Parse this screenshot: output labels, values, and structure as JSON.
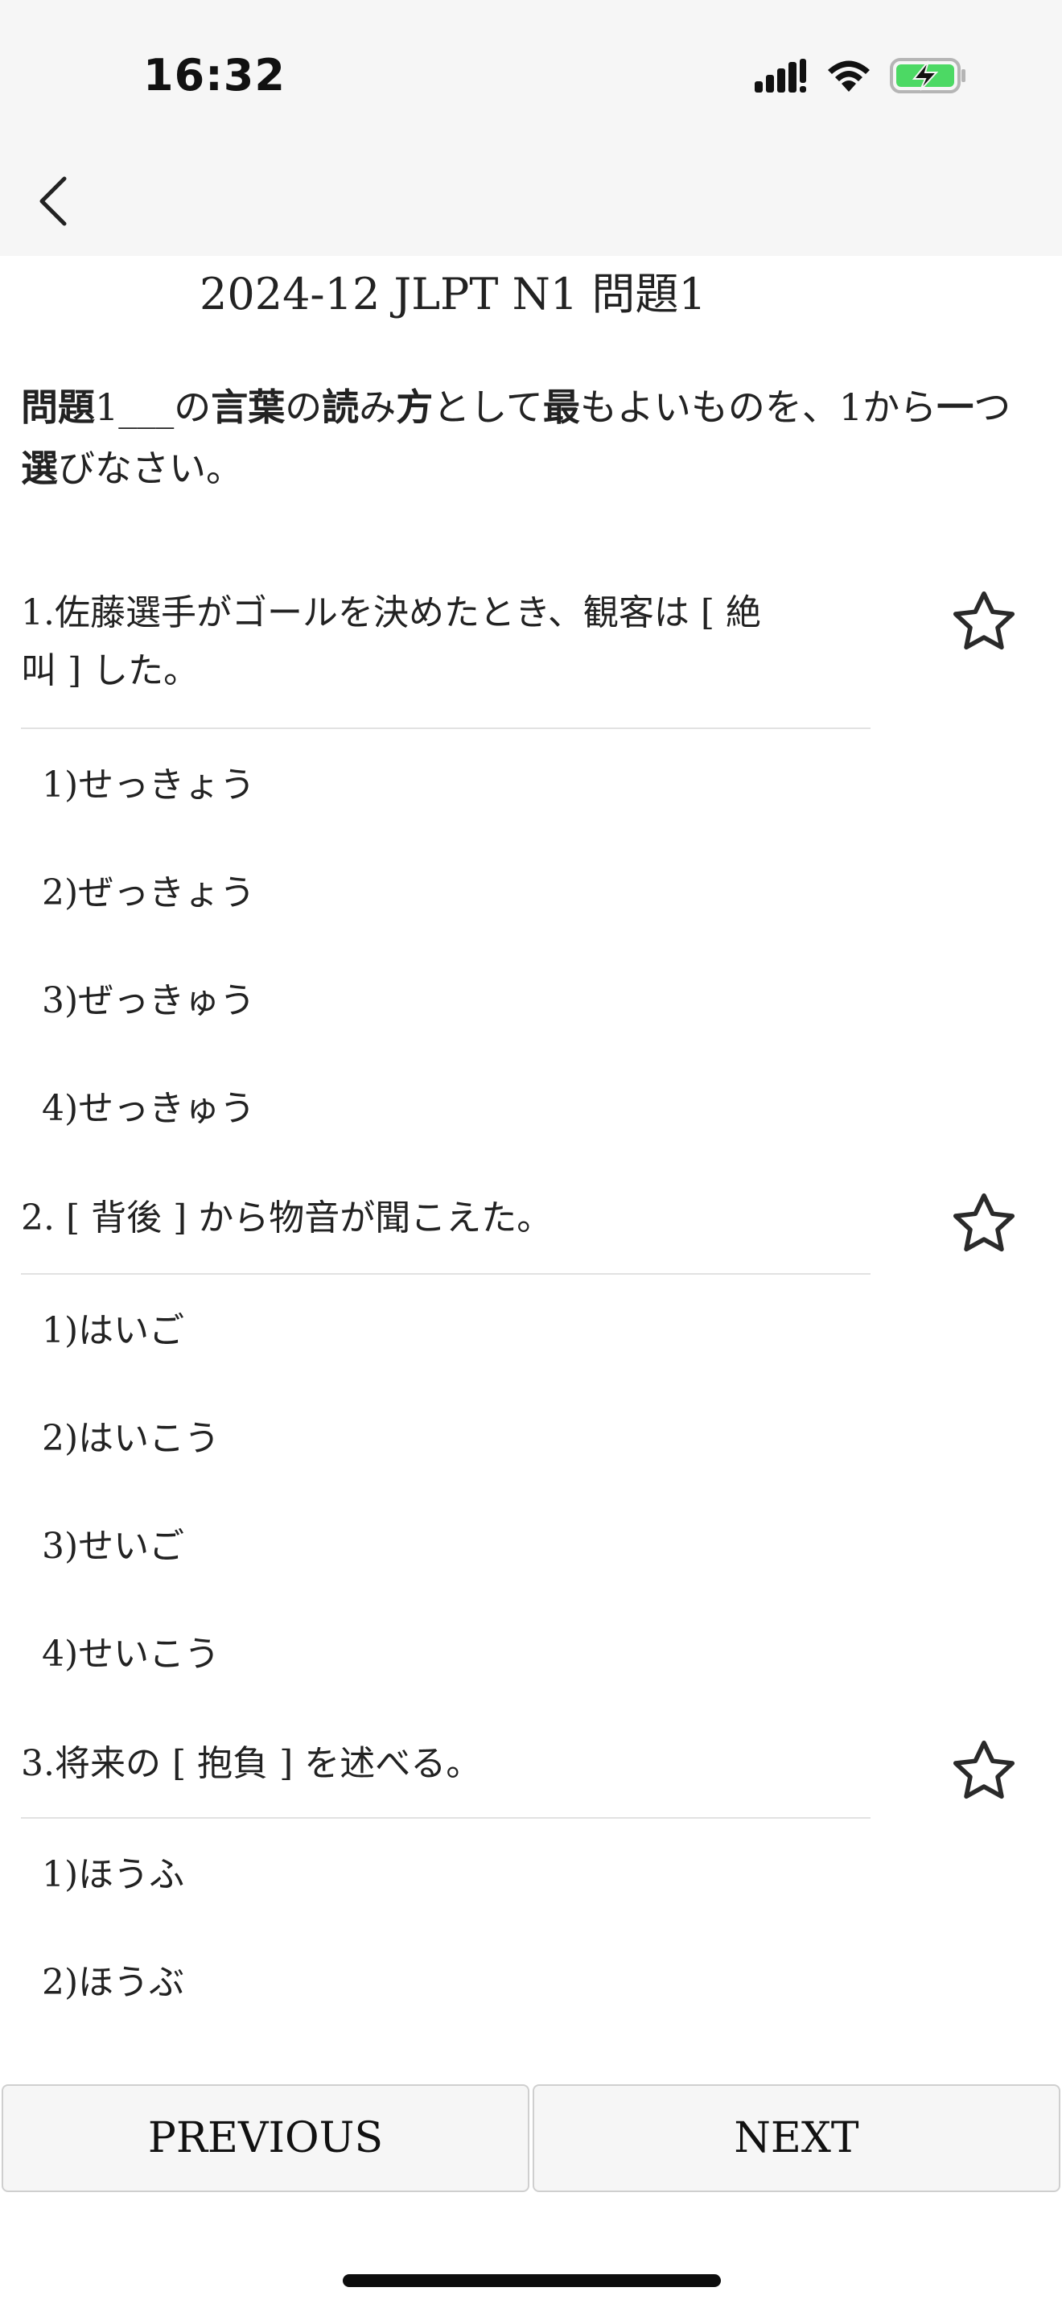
{
  "status_bar": {
    "time": "16:32",
    "icons": [
      "cellular-signal-icon",
      "wifi-icon",
      "battery-charging-icon"
    ],
    "battery_color": "#4cd964"
  },
  "nav": {
    "back_icon": "chevron-left-icon"
  },
  "page": {
    "title": "2024-12 JLPT N1 問題1",
    "instruction_bold_1": "問題",
    "instruction_text_1": "1___の",
    "instruction_bold_2": "言葉",
    "instruction_text_2": "の",
    "instruction_bold_3": "読",
    "instruction_text_3": "み",
    "instruction_bold_4": "方",
    "instruction_text_4": "として",
    "instruction_bold_5": "最",
    "instruction_text_5": "もよいものを、1から",
    "instruction_bold_6": "一",
    "instruction_text_6": "つ",
    "instruction_bold_7": "選",
    "instruction_text_7": "びなさい。"
  },
  "questions": [
    {
      "text": "1.佐藤選手がゴールを決めたとき、観客は [ 絶叫 ] した。",
      "options": [
        "1)せっきょう",
        "2)ぜっきょう",
        "3)ぜっきゅう",
        "4)せっきゅう"
      ]
    },
    {
      "text": "2. [ 背後 ] から物音が聞こえた。",
      "options": [
        "1)はいご",
        "2)はいこう",
        "3)せいご",
        "4)せいこう"
      ]
    },
    {
      "text": "3.将来の [ 抱負 ] を述べる。",
      "options": [
        "1)ほうふ",
        "2)ほうぶ"
      ]
    }
  ],
  "footer": {
    "previous_label": "PREVIOUS",
    "next_label": "NEXT"
  }
}
